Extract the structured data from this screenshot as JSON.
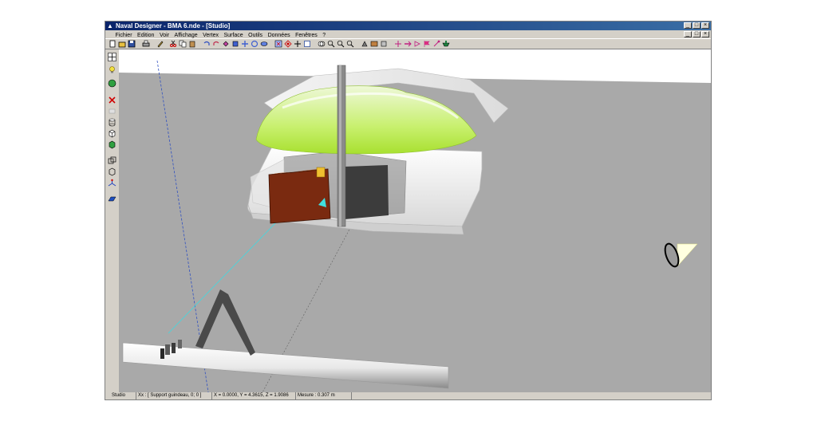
{
  "window": {
    "title": "Naval Designer - BMA 6.nde - [Studio]",
    "controls": [
      "_",
      "□",
      "×"
    ]
  },
  "menu": {
    "items": [
      "Fichier",
      "Edition",
      "Voir",
      "Affichage",
      "Vertex",
      "Surface",
      "Outils",
      "Données",
      "Fenêtres",
      "?"
    ]
  },
  "status": {
    "mode": "Studio",
    "selection": "Xx : [ Support guindeau, 0; 0 ]",
    "coords": "X = 0.0000, Y = 4.3615, Z = 1.9086",
    "measure": "Mesure : 0.307 m"
  },
  "colors": {
    "titlebar_start": "#0a246a",
    "titlebar_end": "#3a6ea5",
    "chrome": "#d4d0c8",
    "viewport_ground": "#a9a9a9",
    "dome": "#c8f06e",
    "crate": "#7a2a10"
  },
  "toolbar_icons": [
    "new-icon",
    "open-icon",
    "save-icon",
    "print-icon",
    "pencil-icon",
    "scissors-icon",
    "copy-icon",
    "paste-icon",
    "undo-icon",
    "redo-icon",
    "select-icon",
    "cube-icon",
    "move-icon",
    "rotate-icon",
    "scale-icon",
    "zoom-icon",
    "zoom-in-icon",
    "zoom-out-icon",
    "zoom-window-icon",
    "camera-icon",
    "light-icon",
    "grid-icon",
    "measure-icon",
    "flag-icon",
    "export-icon",
    "render-icon"
  ],
  "left_icons": [
    "cursor-icon",
    "light-bulb-icon",
    "sphere-icon",
    "delete-icon",
    "layer-icon",
    "cylinder-icon",
    "box-icon",
    "green-box-icon",
    "frame-icon",
    "wire-icon",
    "axis-icon",
    "plane-icon"
  ]
}
